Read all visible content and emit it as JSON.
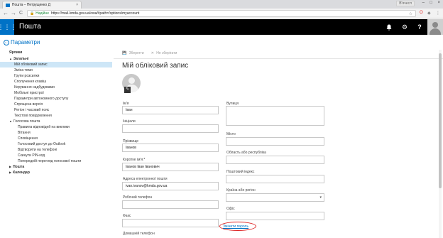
{
  "browser": {
    "tab_title": "Пошта – Петрущенко Д",
    "tab_close": "×",
    "profile_label": "В'ячесл",
    "secure_label": "Надійне",
    "url": "https://mail.kmda.gov.ua/owa/#path=/options/myaccount",
    "back": "←",
    "forward": "→",
    "reload": "C",
    "star": "☆",
    "minimize": "–",
    "maximize": "□",
    "close": "×"
  },
  "owa": {
    "app_title": "Пошта",
    "waffle": "⋮⋮⋮",
    "bell": "🔔",
    "gear": "⚙",
    "help": "?"
  },
  "sidebar": {
    "back_label": "Параметри",
    "items": [
      {
        "label": "Ярлики",
        "level": "head"
      },
      {
        "label": "Загальні",
        "level": "head",
        "caret": "▲"
      },
      {
        "label": "Мій обліковий запис",
        "level": "l1",
        "selected": true
      },
      {
        "label": "Зміна теми",
        "level": "l1"
      },
      {
        "label": "Групи розсилки",
        "level": "l1"
      },
      {
        "label": "Сполучення клавіш",
        "level": "l1"
      },
      {
        "label": "Керування надбудовами",
        "level": "l1"
      },
      {
        "label": "Мобільні пристрої",
        "level": "l1"
      },
      {
        "label": "Параметри автономного доступу",
        "level": "l1"
      },
      {
        "label": "Спрощена версія",
        "level": "l1"
      },
      {
        "label": "Регіон і часовий пояс",
        "level": "l1"
      },
      {
        "label": "Текстові повідомлення",
        "level": "l1"
      },
      {
        "label": "Голосова пошта",
        "level": "l1b",
        "caret": "▲"
      },
      {
        "label": "Правила відповідей на виклики",
        "level": "l2"
      },
      {
        "label": "Вітання",
        "level": "l2"
      },
      {
        "label": "Сповіщення",
        "level": "l2"
      },
      {
        "label": "Голосовий доступ до Outlook",
        "level": "l2"
      },
      {
        "label": "Відтворити на телефоні",
        "level": "l2"
      },
      {
        "label": "Скинути PIN-код",
        "level": "l2"
      },
      {
        "label": "Попередній перегляд голосової пошти",
        "level": "l2"
      },
      {
        "label": "Пошта",
        "level": "head",
        "caret": "▶"
      },
      {
        "label": "Календар",
        "level": "head",
        "caret": "▶"
      }
    ]
  },
  "toolbar": {
    "save_icon": "💾",
    "save_label": "Зберегти",
    "discard_icon": "✕",
    "discard_label": "Не зберігати"
  },
  "page": {
    "title": "Мій обліковий запис"
  },
  "form": {
    "first_name": {
      "label": "Ім'я",
      "value": "Іван"
    },
    "initials": {
      "label": "Ініціали",
      "value": ""
    },
    "last_name": {
      "label": "Прізвище",
      "value": "Іванов"
    },
    "display_name": {
      "label": "Коротке ім'я:*",
      "value": "Іванов Іван Іванович"
    },
    "email": {
      "label": "Адреса електронної пошти",
      "value": "ivan.ivanov@kmda.gov.ua"
    },
    "work_phone": {
      "label": "Робочий телефон",
      "value": ""
    },
    "fax": {
      "label": "Факс",
      "value": ""
    },
    "home_phone": {
      "label": "Домашній телефон",
      "value": ""
    },
    "street": {
      "label": "Вулиця",
      "value": ""
    },
    "city": {
      "label": "Місто",
      "value": ""
    },
    "state": {
      "label": "Область або республіка",
      "value": ""
    },
    "postal": {
      "label": "Поштовий індекс",
      "value": ""
    },
    "country": {
      "label": "Країна або регіон",
      "value": "",
      "arrow": "▾"
    },
    "office": {
      "label": "Офіс",
      "value": ""
    },
    "change_password": "Змінити пароль"
  }
}
